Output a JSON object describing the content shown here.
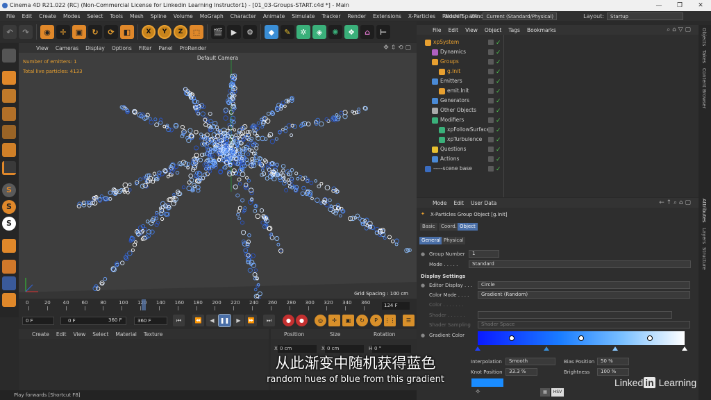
{
  "window": {
    "title": "Cinema 4D R21.022 (RC) (Non-Commercial License for Linkedin Learning Instructor1) - [01_03-Groups-START.c4d *] - Main",
    "controls": [
      "—",
      "❐",
      "✕"
    ]
  },
  "menubar": {
    "items": [
      "File",
      "Edit",
      "Create",
      "Modes",
      "Select",
      "Tools",
      "Mesh",
      "Spline",
      "Volume",
      "MoGraph",
      "Character",
      "Animate",
      "Simulate",
      "Tracker",
      "Render",
      "Extensions",
      "X-Particles",
      "Redshift",
      "Window"
    ],
    "node_space_label": "Node Space:",
    "node_space_value": "Current (Standard/Physical)",
    "layout_label": "Layout:",
    "layout_value": "Startup"
  },
  "toolbar": {
    "x": "X",
    "y": "Y",
    "z": "Z"
  },
  "viewport": {
    "menu": [
      "View",
      "Cameras",
      "Display",
      "Options",
      "Filter",
      "Panel",
      "ProRender"
    ],
    "camera": "Default Camera",
    "emitters": "Number of emitters: 1",
    "particles": "Total live particles: 4133",
    "grid_spacing": "Grid Spacing : 100 cm"
  },
  "timeline": {
    "ticks": [
      "0",
      "20",
      "40",
      "60",
      "80",
      "100",
      "120",
      "140",
      "160",
      "180",
      "200",
      "220",
      "240",
      "260",
      "280",
      "300",
      "320",
      "340",
      "360"
    ],
    "current_frame": "124 F",
    "playhead_fraction": 0.344
  },
  "transport": {
    "start": "0 F",
    "range_start": "0 F",
    "range_end": "360 F",
    "end": "360 F"
  },
  "material": {
    "menu": [
      "Create",
      "Edit",
      "View",
      "Select",
      "Material",
      "Texture"
    ]
  },
  "coordinates": {
    "headers": [
      "Position",
      "Size",
      "Rotation"
    ],
    "x_label": "X",
    "x_pos": "0 cm",
    "x_size_label": "X",
    "x_size": "0 cm",
    "h_label": "H",
    "h_rot": "0 °"
  },
  "status": "Play forwards [Shortcut F8]",
  "object_manager": {
    "menu": [
      "File",
      "Edit",
      "View",
      "Object",
      "Tags",
      "Bookmarks"
    ],
    "objects": [
      {
        "name": "xpSystem",
        "color": "#e8a030"
      },
      {
        "name": "Dynamics",
        "color": "#cfcfcf"
      },
      {
        "name": "Groups",
        "color": "#e8a030"
      },
      {
        "name": "g.Init",
        "color": "#e8a030"
      },
      {
        "name": "Emitters",
        "color": "#cfcfcf"
      },
      {
        "name": "emit.Init",
        "color": "#cfcfcf"
      },
      {
        "name": "Generators",
        "color": "#cfcfcf"
      },
      {
        "name": "Other Objects",
        "color": "#cfcfcf"
      },
      {
        "name": "Modifiers",
        "color": "#cfcfcf"
      },
      {
        "name": "xpFollowSurface",
        "color": "#cfcfcf"
      },
      {
        "name": "xpTurbulence",
        "color": "#cfcfcf"
      },
      {
        "name": "Questions",
        "color": "#cfcfcf"
      },
      {
        "name": "Actions",
        "color": "#cfcfcf"
      },
      {
        "name": "-----scene base",
        "color": "#cfcfcf"
      }
    ]
  },
  "attributes": {
    "menu": [
      "Mode",
      "Edit",
      "User Data"
    ],
    "object_title": "X-Particles Group Object [g.Init]",
    "tabs": [
      "Basic",
      "Coord.",
      "Object"
    ],
    "subtabs": [
      "General",
      "Physical"
    ],
    "group_number_label": "Group Number",
    "group_number": "1",
    "mode_label": "Mode . . . . .",
    "mode_value": "Standard",
    "display_settings": "Display Settings",
    "editor_display_label": "Editor Display . . .",
    "editor_display_value": "Circle",
    "color_mode_label": "Color Mode . . . .",
    "color_mode_value": "Gradient (Random)",
    "color_label": "Color . . . . . . .",
    "shader_label": "Shader . . . . . .",
    "shader_sampling_label": "Shader Sampling",
    "shader_sampling_value": "Shader Space",
    "gradient_color_label": "Gradient Color",
    "interpolation_label": "Interpolation",
    "interpolation_value": "Smooth",
    "knot_position_label": "Knot Position",
    "knot_position": "33.3 %",
    "bias_position_label": "Bias Position",
    "bias_position": "50 %",
    "brightness_label": "Brightness",
    "brightness": "100 %",
    "hsv_label": "HSV",
    "knot_color": "#1a8cff"
  },
  "right_tabs": [
    "Objects",
    "Takes",
    "Content Browser",
    "Attributes",
    "Layers",
    "Structure"
  ],
  "subtitles": {
    "zh": "从此渐变中随机获得蓝色",
    "en": "random hues of blue from this gradient"
  },
  "watermark": {
    "text1": "Linked",
    "badge": "in",
    "text2": "Learning"
  }
}
